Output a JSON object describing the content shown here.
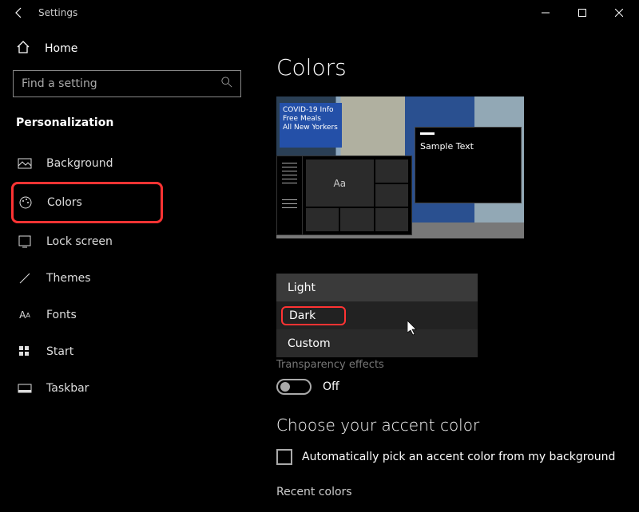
{
  "title": "Settings",
  "home_label": "Home",
  "search_placeholder": "Find a setting",
  "section": "Personalization",
  "nav": {
    "background": "Background",
    "colors": "Colors",
    "lockscreen": "Lock screen",
    "themes": "Themes",
    "fonts": "Fonts",
    "start": "Start",
    "taskbar": "Taskbar"
  },
  "page": {
    "title": "Colors",
    "sample_text": "Sample Text",
    "aa": "Aa",
    "billboard_text": "COVID-19 Info\nFree Meals\nAll New Yorkers",
    "options": {
      "light": "Light",
      "dark": "Dark",
      "custom": "Custom"
    },
    "transparency_label": "Transparency effects",
    "toggle_state": "Off",
    "accent_heading": "Choose your accent color",
    "auto_pick": "Automatically pick an accent color from my background",
    "recent": "Recent colors"
  }
}
